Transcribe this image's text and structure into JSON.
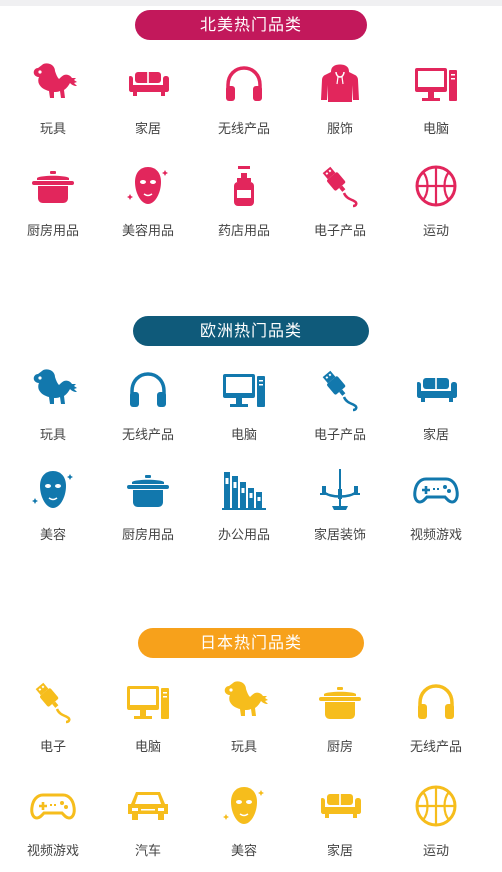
{
  "sections": [
    {
      "title": "北美热门品类",
      "color": "#c2185b",
      "icon_color": "#e2265c",
      "rows": [
        [
          {
            "label": "玩具",
            "icon": "dinosaur-icon"
          },
          {
            "label": "家居",
            "icon": "sofa-icon"
          },
          {
            "label": "无线产品",
            "icon": "headphones-icon"
          },
          {
            "label": "服饰",
            "icon": "hoodie-icon"
          },
          {
            "label": "电脑",
            "icon": "computer-icon"
          }
        ],
        [
          {
            "label": "厨房用品",
            "icon": "pot-icon"
          },
          {
            "label": "美容用品",
            "icon": "face-mask-icon"
          },
          {
            "label": "药店用品",
            "icon": "pump-bottle-icon"
          },
          {
            "label": "电子产品",
            "icon": "usb-cable-icon"
          },
          {
            "label": "运动",
            "icon": "basketball-icon"
          }
        ]
      ]
    },
    {
      "title": "欧洲热门品类",
      "color": "#0f5a7a",
      "icon_color": "#1278ad",
      "rows": [
        [
          {
            "label": "玩具",
            "icon": "dinosaur-icon"
          },
          {
            "label": "无线产品",
            "icon": "headphones-icon"
          },
          {
            "label": "电脑",
            "icon": "computer-icon"
          },
          {
            "label": "电子产品",
            "icon": "usb-cable-icon"
          },
          {
            "label": "家居",
            "icon": "sofa-icon"
          }
        ],
        [
          {
            "label": "美容",
            "icon": "face-mask-icon"
          },
          {
            "label": "厨房用品",
            "icon": "pot-icon"
          },
          {
            "label": "办公用品",
            "icon": "binders-icon"
          },
          {
            "label": "家居装饰",
            "icon": "chandelier-icon"
          },
          {
            "label": "视频游戏",
            "icon": "gamepad-icon"
          }
        ]
      ]
    },
    {
      "title": "日本热门品类",
      "color": "#f7a11b",
      "icon_color": "#f6bd1c",
      "rows": [
        [
          {
            "label": "电子",
            "icon": "usb-cable-icon"
          },
          {
            "label": "电脑",
            "icon": "computer-icon"
          },
          {
            "label": "玩具",
            "icon": "dinosaur-icon"
          },
          {
            "label": "厨房",
            "icon": "pot-icon"
          },
          {
            "label": "无线产品",
            "icon": "headphones-icon"
          }
        ],
        [
          {
            "label": "视频游戏",
            "icon": "gamepad-icon"
          },
          {
            "label": "汽车",
            "icon": "car-icon"
          },
          {
            "label": "美容",
            "icon": "face-mask-icon"
          },
          {
            "label": "家居",
            "icon": "sofa-icon"
          },
          {
            "label": "运动",
            "icon": "basketball-icon"
          }
        ]
      ]
    }
  ]
}
